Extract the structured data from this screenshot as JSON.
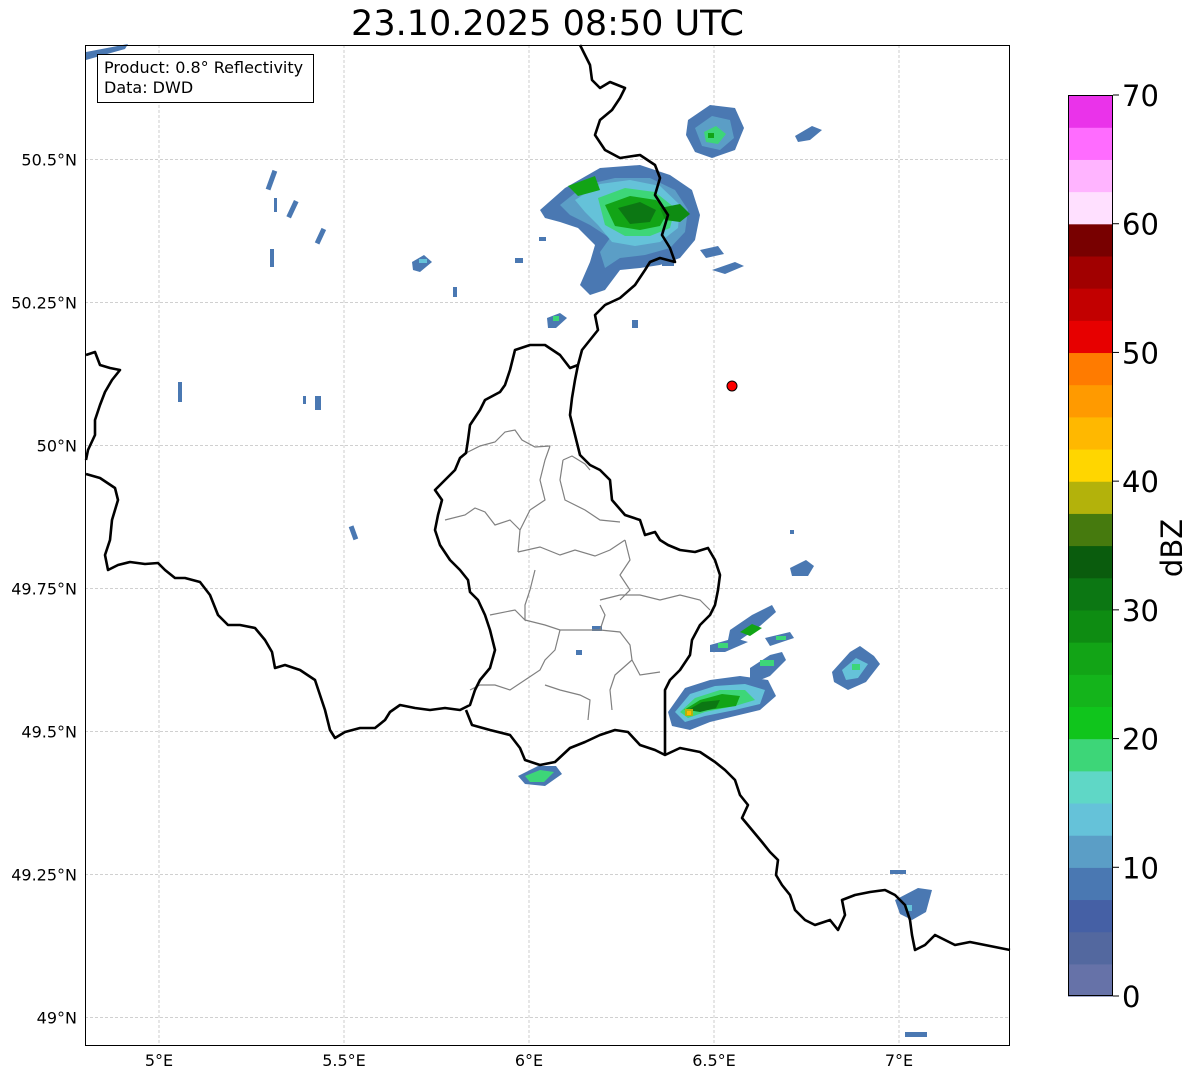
{
  "title": "23.10.2025 08:50 UTC",
  "info": {
    "product": "Product: 0.8° Reflectivity",
    "data": "Data: DWD"
  },
  "axes": {
    "x_ticks": [
      "5°E",
      "5.5°E",
      "6°E",
      "6.5°E",
      "7°E"
    ],
    "y_ticks": [
      "50.5°N",
      "50.25°N",
      "50°N",
      "49.75°N",
      "49.5°N",
      "49.25°N",
      "49°N"
    ],
    "lon_range": [
      4.8,
      7.3
    ],
    "lat_range": [
      48.95,
      50.7
    ]
  },
  "colorbar": {
    "label": "dBZ",
    "ticks": [
      "0",
      "10",
      "20",
      "30",
      "40",
      "50",
      "60",
      "70"
    ],
    "colors": [
      "#6672a8",
      "#53689f",
      "#4560a5",
      "#4a78b2",
      "#5b9ec6",
      "#65c2d9",
      "#5fd7c6",
      "#3dd678",
      "#10c51c",
      "#14b41b",
      "#12a416",
      "#0e8c12",
      "#0c7713",
      "#0a5c0d",
      "#467a0e",
      "#b3b20b",
      "#ffd600",
      "#ffb800",
      "#ff9a00",
      "#ff7b00",
      "#e70000",
      "#c20000",
      "#a10000",
      "#780000",
      "#ffe0ff",
      "#ffb4ff",
      "#ff6cff",
      "#ea33ea"
    ]
  },
  "colors": {
    "border": "#000000",
    "canton": "#808080",
    "grid": "#c0c0c0",
    "radar_site": "#ff0000"
  }
}
